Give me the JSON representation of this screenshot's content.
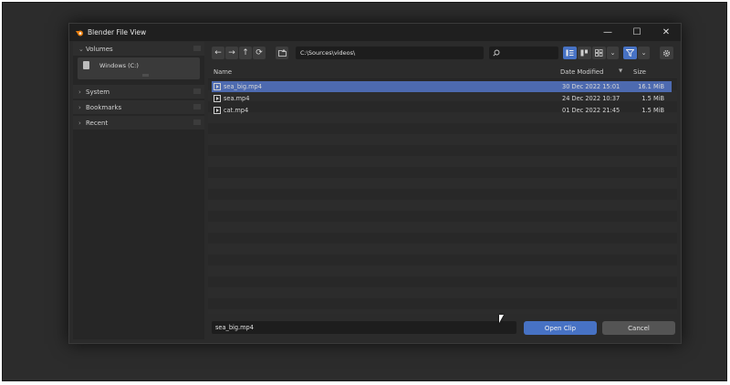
{
  "window": {
    "title": "Blender File View",
    "controls": {
      "minimize": "—",
      "maximize": "☐",
      "close": "✕"
    }
  },
  "sidebar": {
    "volumes": {
      "header": "Volumes",
      "drive_label": "Windows (C:)"
    },
    "system": {
      "header": "System"
    },
    "bookmarks": {
      "header": "Bookmarks"
    },
    "recent": {
      "header": "Recent"
    }
  },
  "toolbar": {
    "back": "←",
    "forward": "→",
    "parent": "↑",
    "refresh": "⟳",
    "path": "C:\\Sources\\videos\\",
    "search_placeholder": ""
  },
  "columns": {
    "name": "Name",
    "date": "Date Modified",
    "size": "Size",
    "sort_indicator": "▼"
  },
  "files": [
    {
      "name": "sea_big.mp4",
      "date": "30 Dec 2022 15:01",
      "size": "16.1 MiB",
      "selected": true
    },
    {
      "name": "sea.mp4",
      "date": "24 Dec 2022 10:37",
      "size": "1.5 MiB",
      "selected": false
    },
    {
      "name": "cat.mp4",
      "date": "01 Dec 2022 21:45",
      "size": "1.5 MiB",
      "selected": false
    }
  ],
  "footer": {
    "filename": "sea_big.mp4",
    "open_label": "Open Clip",
    "cancel_label": "Cancel"
  },
  "colors": {
    "accent": "#4772c4",
    "selection": "#4d6ab0"
  }
}
